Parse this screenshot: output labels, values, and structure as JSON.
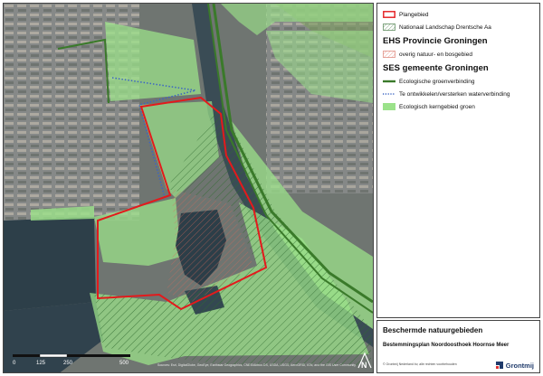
{
  "legend": {
    "plangebied": "Plangebied",
    "nationaal_landschap": "Nationaal Landschap Drentsche Aa",
    "ehs_heading": "EHS Provincie Groningen",
    "overig_natuur": "overig natuur- en bosgebied",
    "ses_heading": "SES gemeente Groningen",
    "groenverbinding": "Ecologische groenverbinding",
    "waterverbinding": "Te ontwikkelen/versterken waterverbinding",
    "kerngebied": "Ecologisch kerngebied groen"
  },
  "title_block": {
    "main_title": "Beschermde natuurgebieden",
    "subtitle": "Bestemmingsplan Noordoosthoek Hoornse Meer",
    "footer": "© Grontmij Nederland bv, alle rechten voorbehouden",
    "company": "Grontmij"
  },
  "scale": {
    "labels": [
      "0",
      "125",
      "250",
      "500"
    ]
  },
  "north_label": "N",
  "copyright_text": "Sources: Esri, DigitalGlobe, GeoEye, Earthstar Geographics, CNES/Airbus DS, USDA, USGS, AeroGRID, IGN, and the GIS User Community",
  "colors": {
    "plangebied_border": "#e31a1c",
    "hatch_green": "#2f6b2f",
    "hatch_red": "#e08070",
    "groenverbinding": "#3a7a2a",
    "waterverbinding": "#3b64c4",
    "kerngebied": "#9be28a",
    "water": "#2c3e48"
  }
}
